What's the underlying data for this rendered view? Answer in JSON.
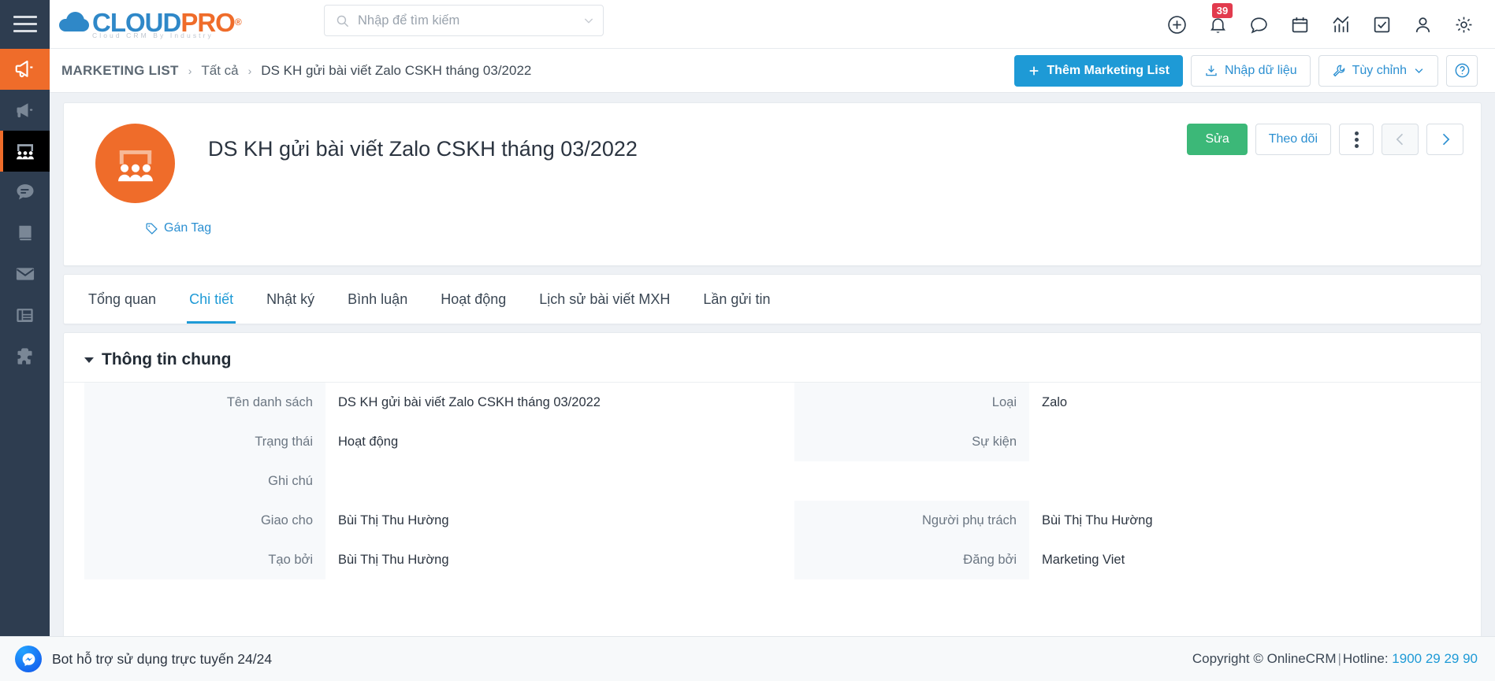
{
  "topbar": {
    "menu_icon": "hamburger-icon",
    "logo": {
      "cloud": "CLOUD",
      "pro": "PRO",
      "registered": "®",
      "tagline": "Cloud CRM By Industry"
    },
    "search": {
      "placeholder": "Nhập để tìm kiếm",
      "value": "",
      "icon": "search-icon",
      "caret": "chevron-down-icon"
    },
    "icons": [
      {
        "name": "add-circle-icon",
        "badge": ""
      },
      {
        "name": "bell-icon",
        "badge": "39"
      },
      {
        "name": "chat-bubble-icon",
        "badge": ""
      },
      {
        "name": "calendar-icon",
        "badge": ""
      },
      {
        "name": "analytics-icon",
        "badge": ""
      },
      {
        "name": "task-check-icon",
        "badge": ""
      },
      {
        "name": "user-icon",
        "badge": ""
      },
      {
        "name": "gear-icon",
        "badge": ""
      }
    ]
  },
  "sidebar": {
    "items": [
      {
        "name": "campaign-megaphone",
        "state": "highlight"
      },
      {
        "name": "marketing-megaphone",
        "state": "normal"
      },
      {
        "name": "marketing-list-audience",
        "state": "active"
      },
      {
        "name": "sms-chat",
        "state": "normal"
      },
      {
        "name": "catalog-book",
        "state": "normal"
      },
      {
        "name": "email-envelope",
        "state": "normal"
      },
      {
        "name": "landing-page-form",
        "state": "normal"
      },
      {
        "name": "integration-puzzle",
        "state": "normal"
      }
    ]
  },
  "breadcrumb": {
    "root": "MARKETING LIST",
    "separator": "›",
    "items": [
      "Tất cả",
      "DS KH gửi bài viết Zalo CSKH tháng 03/2022"
    ]
  },
  "page_actions": {
    "add": {
      "label": "Thêm Marketing List",
      "icon": "plus-icon"
    },
    "import": {
      "label": "Nhập dữ liệu",
      "icon": "download-import-icon"
    },
    "customize": {
      "label": "Tùy chỉnh",
      "icon": "wrench-icon",
      "caret": "chevron-down-icon"
    },
    "help": {
      "icon": "question-circle-icon"
    }
  },
  "record": {
    "avatar_icon": "audience-group-icon",
    "avatar_color": "#ef6c2a",
    "title": "DS KH gửi bài viết Zalo CSKH tháng 03/2022",
    "tag_link": {
      "label": "Gán Tag",
      "icon": "tag-icon"
    },
    "actions": {
      "edit": {
        "label": "Sửa",
        "color": "#3cb878"
      },
      "follow": {
        "label": "Theo dõi",
        "color": "#2b8fd1"
      },
      "more": {
        "icon": "kebab-vertical-icon"
      },
      "prev": {
        "icon": "chevron-left-icon",
        "disabled": true
      },
      "next": {
        "icon": "chevron-right-icon",
        "disabled": false
      }
    }
  },
  "tabs": [
    {
      "label": "Tổng quan",
      "active": false
    },
    {
      "label": "Chi tiết",
      "active": true
    },
    {
      "label": "Nhật ký",
      "active": false
    },
    {
      "label": "Bình luận",
      "active": false
    },
    {
      "label": "Hoạt động",
      "active": false
    },
    {
      "label": "Lịch sử bài viết MXH",
      "active": false
    },
    {
      "label": "Lần gửi tin",
      "active": false
    }
  ],
  "detail": {
    "section_title": "Thông tin chung",
    "collapse_icon": "caret-down-icon",
    "left_fields": [
      {
        "label": "Tên danh sách",
        "value": "DS KH gửi bài viết Zalo CSKH tháng 03/2022"
      },
      {
        "label": "Trạng thái",
        "value": "Hoạt động"
      },
      {
        "label": "Ghi chú",
        "value": ""
      },
      {
        "label": "Giao cho",
        "value": "Bùi Thị Thu Hường"
      },
      {
        "label": "Tạo bởi",
        "value": "Bùi Thị Thu Hường"
      }
    ],
    "right_fields": [
      {
        "label": "Loại",
        "value": "Zalo"
      },
      {
        "label": "Sự kiện",
        "value": ""
      },
      {
        "label": "",
        "value": ""
      },
      {
        "label": "Người phụ trách",
        "value": "Bùi Thị Thu Hường"
      },
      {
        "label": "Đăng bởi",
        "value": "Marketing Viet"
      }
    ]
  },
  "footer": {
    "chat": {
      "label": "Bot hỗ trợ sử dụng trực tuyến 24/24",
      "icon": "messenger-icon"
    },
    "copyright_prefix": "Copyright © OnlineCRM",
    "divider": "|",
    "hotline_label": "Hotline:",
    "hotline": "1900 29 29 90"
  }
}
